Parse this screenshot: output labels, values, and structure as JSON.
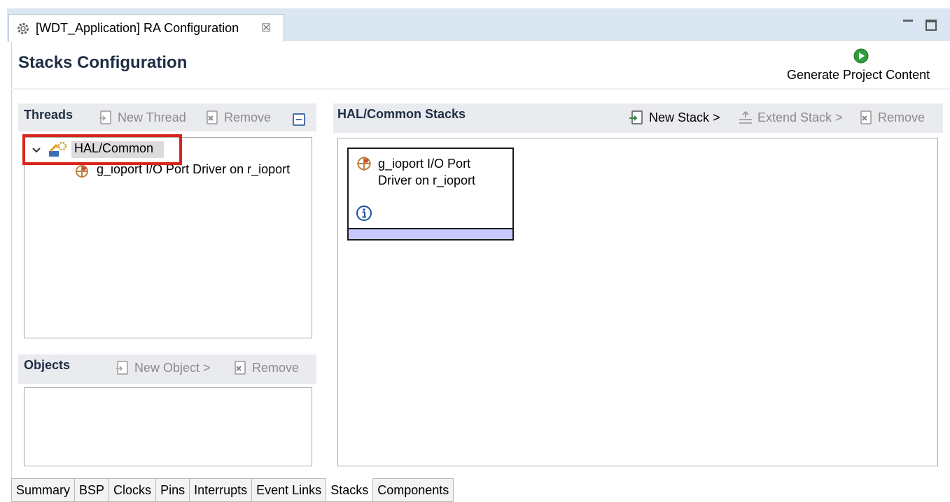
{
  "editor_tab": {
    "title": "[WDT_Application] RA Configuration",
    "close_glyph": "☒"
  },
  "page": {
    "title": "Stacks Configuration",
    "generate_label": "Generate Project Content"
  },
  "threads": {
    "title": "Threads",
    "new_thread": "New Thread",
    "remove": "Remove",
    "tree": {
      "node_label": "HAL/Common",
      "child_label": "g_ioport I/O Port Driver on r_ioport"
    }
  },
  "objects": {
    "title": "Objects",
    "new_object": "New Object >",
    "remove": "Remove"
  },
  "stacks": {
    "title": "HAL/Common Stacks",
    "new_stack": "New Stack >",
    "extend_stack": "Extend Stack >",
    "remove": "Remove",
    "card": {
      "name": "g_ioport I/O Port Driver on r_ioport"
    }
  },
  "bottom_tabs": [
    "Summary",
    "BSP",
    "Clocks",
    "Pins",
    "Interrupts",
    "Event Links",
    "Stacks",
    "Components"
  ],
  "active_bottom_tab": "Stacks",
  "colors": {
    "highlight_box": "#d9261c",
    "card_footer": "#c8c8ff",
    "tabstrip": "#dae6f2",
    "generate_icon": "#2f9e3a"
  },
  "icons": {
    "editor_tab": "gear-icon",
    "generate": "play-icon",
    "tree_node": "hal-common-icon",
    "module": "module-icon",
    "info": "info-icon"
  }
}
